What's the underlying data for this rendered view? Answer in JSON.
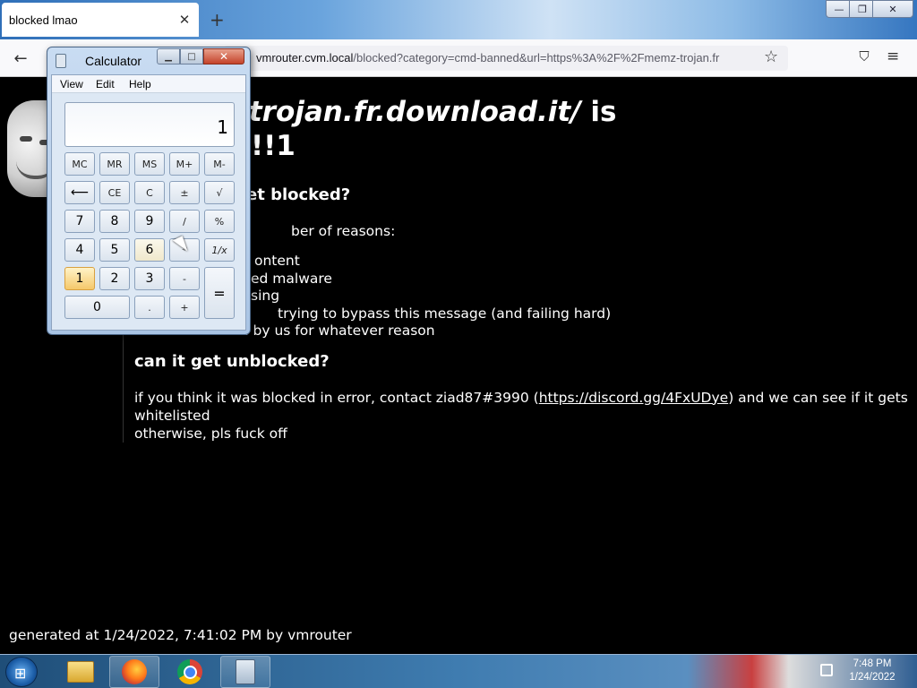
{
  "browser": {
    "tab_title": "blocked lmao",
    "tab_close": "✕",
    "new_tab": "+",
    "window_controls": {
      "minimize": "—",
      "maximize": "❐",
      "close": "✕"
    },
    "back": "←",
    "url_host": "vmrouter.cvm.local",
    "url_rest": "/blocked?category=cmd-banned&url=https%3A%2F%2Fmemz-trojan.fr",
    "star": "☆",
    "pocket": "⛉",
    "menu": "≡"
  },
  "page": {
    "headline_url": "/memz-trojan.fr.download.it/",
    "headline_is": " is",
    "headline_line2": "!!1",
    "why_heading": "et blocked?",
    "reasons_intro": "ber of reasons:",
    "reasons": [
      "ontent",
      "ed malware",
      "sing",
      " trying to bypass this message (and failing hard)",
      "it's blocked by us for whatever reason"
    ],
    "unblock_heading": "can it get unblocked?",
    "contact_before": "if you think it was blocked in error, contact ziad87#3990 (",
    "contact_link": "https://discord.gg/4FxUDye",
    "contact_after": ") and we can see if it gets whitelisted",
    "otherwise": "otherwise, pls fuck off",
    "footer": "generated at 1/24/2022, 7:41:02 PM by vmrouter"
  },
  "calculator": {
    "title": "Calculator",
    "window_controls": {
      "minimize": "▁",
      "maximize": "□",
      "close": "✕"
    },
    "menus": {
      "view": "View",
      "edit": "Edit",
      "help": "Help"
    },
    "display": "1",
    "keys": {
      "mc": "MC",
      "mr": "MR",
      "ms": "MS",
      "mplus": "M+",
      "mminus": "M-",
      "back": "⟵",
      "ce": "CE",
      "c": "C",
      "plusminus": "±",
      "sqrt": "√",
      "k7": "7",
      "k8": "8",
      "k9": "9",
      "div": "/",
      "pct": "%",
      "k4": "4",
      "k5": "5",
      "k6": "6",
      "mul": "*",
      "recip": "1/x",
      "k1": "1",
      "k2": "2",
      "k3": "3",
      "minus": "-",
      "equals": "=",
      "k0": "0",
      "dot": ".",
      "plus": "+"
    }
  },
  "taskbar": {
    "start": "⊞",
    "clock_time": "7:48 PM",
    "clock_date": "1/24/2022"
  }
}
